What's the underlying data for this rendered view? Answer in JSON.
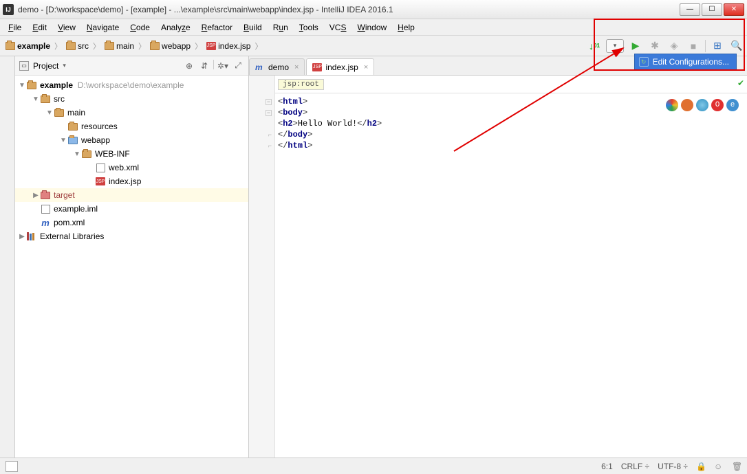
{
  "title": "demo - [D:\\workspace\\demo] - [example] - ...\\example\\src\\main\\webapp\\index.jsp - IntelliJ IDEA 2016.1",
  "menu": [
    "File",
    "Edit",
    "View",
    "Navigate",
    "Code",
    "Analyze",
    "Refactor",
    "Build",
    "Run",
    "Tools",
    "VCS",
    "Window",
    "Help"
  ],
  "breadcrumb": [
    "example",
    "src",
    "main",
    "webapp",
    "index.jsp"
  ],
  "project_label": "Project",
  "tree": {
    "root_name": "example",
    "root_path": "D:\\workspace\\demo\\example",
    "src": "src",
    "main": "main",
    "resources": "resources",
    "webapp": "webapp",
    "webinf": "WEB-INF",
    "webxml": "web.xml",
    "indexjsp": "index.jsp",
    "target": "target",
    "exampleiml": "example.iml",
    "pomxml": "pom.xml",
    "ext_lib": "External Libraries"
  },
  "tabs": {
    "demo": "demo",
    "indexjsp": "index.jsp"
  },
  "code_breadcrumb": "jsp:root",
  "code": {
    "l1a": "<",
    "l1b": "html",
    "l1c": ">",
    "l2a": "<",
    "l2b": "body",
    "l2c": ">",
    "l3a": "<",
    "l3b": "h2",
    "l3c": ">",
    "l3t": "Hello World!",
    "l3d": "</",
    "l3e": "h2",
    "l3f": ">",
    "l4a": "</",
    "l4b": "body",
    "l4c": ">",
    "l5a": "</",
    "l5b": "html",
    "l5c": ">"
  },
  "edit_config": "Edit Configurations...",
  "status": {
    "pos": "6:1",
    "lineend": "CRLF",
    "sep": "․",
    "enc": "UTF-8",
    "encdd": "․"
  }
}
